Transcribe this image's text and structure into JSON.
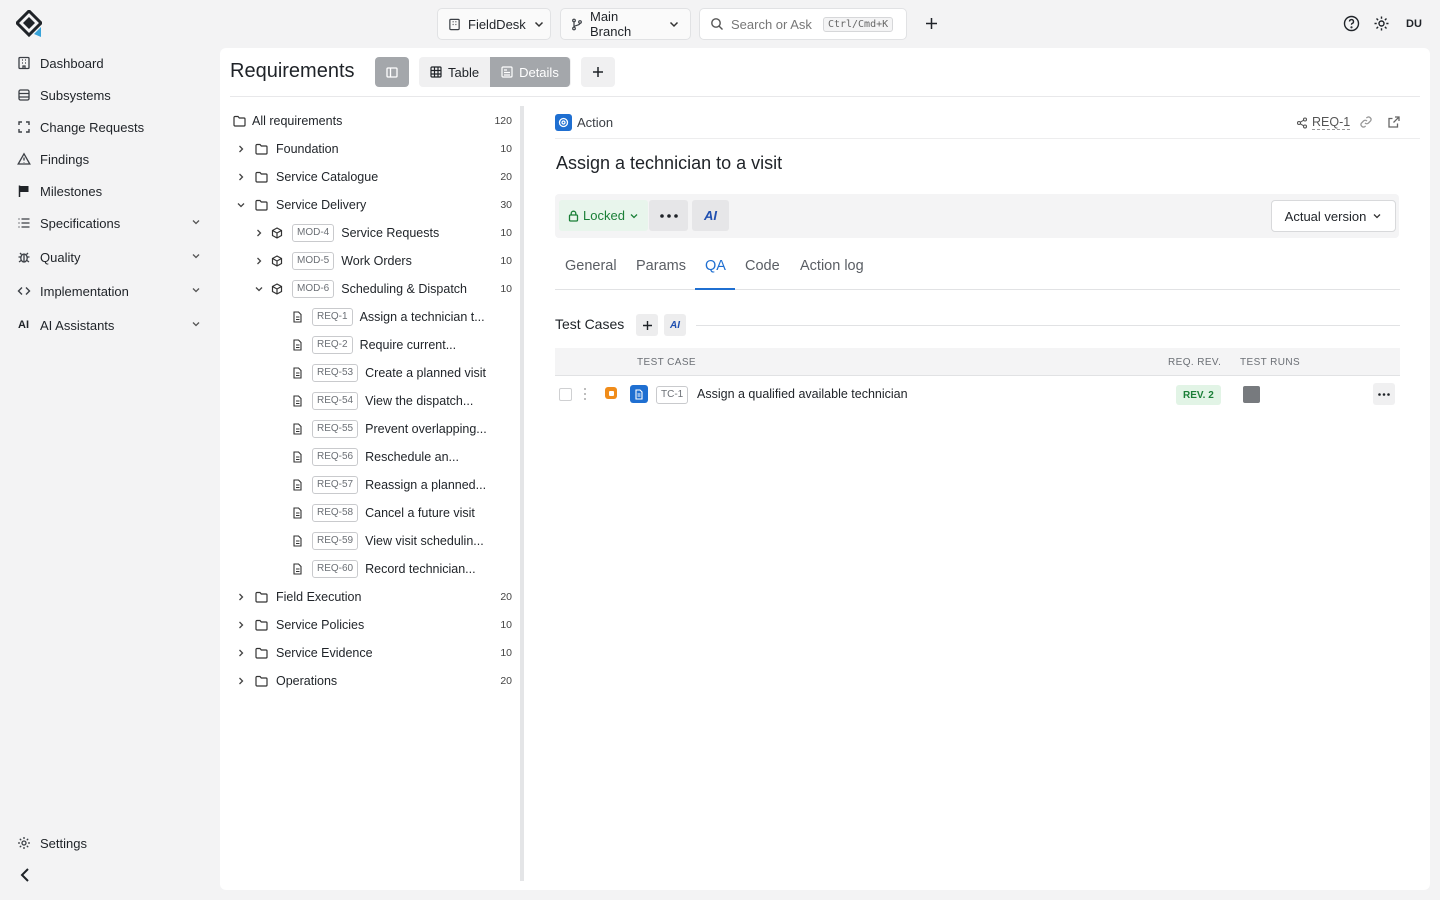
{
  "sidebar": {
    "items": [
      {
        "label": "Dashboard",
        "icon": "building-icon"
      },
      {
        "label": "Subsystems",
        "icon": "database-icon"
      },
      {
        "label": "Change Requests",
        "icon": "scan-icon"
      },
      {
        "label": "Findings",
        "icon": "warning-icon"
      },
      {
        "label": "Milestones",
        "icon": "flag-icon"
      },
      {
        "label": "Specifications",
        "icon": "list-icon"
      },
      {
        "label": "Quality",
        "icon": "bug-icon"
      },
      {
        "label": "Implementation",
        "icon": "code-icon"
      },
      {
        "label": "AI Assistants",
        "icon": "ai-icon"
      }
    ],
    "settings_label": "Settings"
  },
  "topbar": {
    "workspace": "FieldDesk",
    "branch": "Main Branch",
    "search_placeholder": "Search or Ask",
    "search_shortcut": "Ctrl/Cmd+K",
    "avatar": "DU"
  },
  "toolbar": {
    "title": "Requirements",
    "table_label": "Table",
    "details_label": "Details"
  },
  "tree": {
    "root": {
      "label": "All requirements",
      "count": "120"
    },
    "folders_top": [
      {
        "label": "Foundation",
        "count": "10"
      },
      {
        "label": "Service Catalogue",
        "count": "20"
      },
      {
        "label": "Service Delivery",
        "count": "30"
      }
    ],
    "modules": [
      {
        "tag": "MOD-4",
        "label": "Service Requests",
        "count": "10"
      },
      {
        "tag": "MOD-5",
        "label": "Work Orders",
        "count": "10"
      },
      {
        "tag": "MOD-6",
        "label": "Scheduling & Dispatch",
        "count": "10"
      }
    ],
    "requirements": [
      {
        "tag": "REQ-1",
        "label": "Assign a technician t..."
      },
      {
        "tag": "REQ-2",
        "label": "Require current..."
      },
      {
        "tag": "REQ-53",
        "label": "Create a planned visit"
      },
      {
        "tag": "REQ-54",
        "label": "View the dispatch..."
      },
      {
        "tag": "REQ-55",
        "label": "Prevent overlapping..."
      },
      {
        "tag": "REQ-56",
        "label": "Reschedule an..."
      },
      {
        "tag": "REQ-57",
        "label": "Reassign a planned..."
      },
      {
        "tag": "REQ-58",
        "label": "Cancel a future visit"
      },
      {
        "tag": "REQ-59",
        "label": "View visit schedulin..."
      },
      {
        "tag": "REQ-60",
        "label": "Record technician..."
      }
    ],
    "folders_bottom": [
      {
        "label": "Field Execution",
        "count": "20"
      },
      {
        "label": "Service Policies",
        "count": "10"
      },
      {
        "label": "Service Evidence",
        "count": "10"
      },
      {
        "label": "Operations",
        "count": "20"
      }
    ]
  },
  "detail": {
    "type_label": "Action",
    "id": "REQ-1",
    "title": "Assign a technician to a visit",
    "status": "Locked",
    "ai_label": "AI",
    "version": "Actual version",
    "tabs": [
      "General",
      "Params",
      "QA",
      "Code",
      "Action log"
    ],
    "active_tab": "QA",
    "test_cases": {
      "heading": "Test Cases",
      "columns": [
        "TEST CASE",
        "REQ. REV.",
        "TEST RUNS"
      ],
      "rows": [
        {
          "tag": "TC-1",
          "name": "Assign a qualified available technician",
          "rev": "REV. 2"
        }
      ]
    }
  },
  "colors": {
    "accent": "#1f6fd1",
    "locked_green": "#1a7f37",
    "locked_bg": "#e8f5ec",
    "rev_bg": "#e2f4e6",
    "orange": "#f08c1a"
  }
}
